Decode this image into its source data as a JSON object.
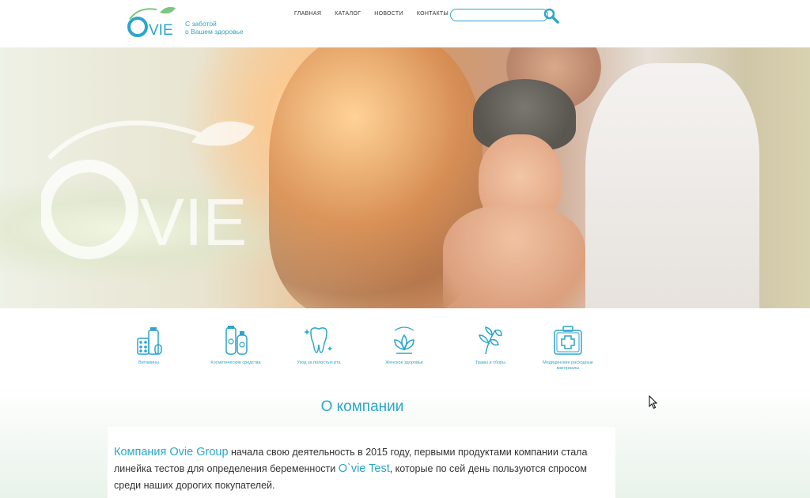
{
  "header": {
    "logo_text": "OVIE",
    "tagline_line1": "С заботой",
    "tagline_line2": "о Вашем здоровье",
    "nav": [
      "ГЛАВНАЯ",
      "КАТАЛОГ",
      "НОВОСТИ",
      "КОНТАКТЫ"
    ],
    "search": {
      "value": "",
      "placeholder": ""
    }
  },
  "hero": {
    "watermark_text": "OVIE"
  },
  "categories": [
    {
      "label": "Витамины",
      "icon": "vitamins-icon"
    },
    {
      "label": "Косметические средства",
      "icon": "cosmetics-icon"
    },
    {
      "label": "Уход за полостью рта",
      "icon": "tooth-icon"
    },
    {
      "label": "Женское здоровье",
      "icon": "lotus-icon"
    },
    {
      "label": "Травы и сборы",
      "icon": "herbs-icon"
    },
    {
      "label": "Медицинские расходные материалы",
      "icon": "first-aid-icon"
    }
  ],
  "about": {
    "title": "О компании",
    "company": "Компания Ovie Group",
    "text1": " начала свою деятельность в 2015 году, первыми продуктами компании стала линейка тестов для определения беременности ",
    "product": "O`vie Test",
    "text2": ", которые по сей день пользуются спросом среди наших дорогих покупателей."
  },
  "colors": {
    "accent": "#2ba6c9",
    "accent_green": "#7dc67e",
    "text": "#333333"
  }
}
